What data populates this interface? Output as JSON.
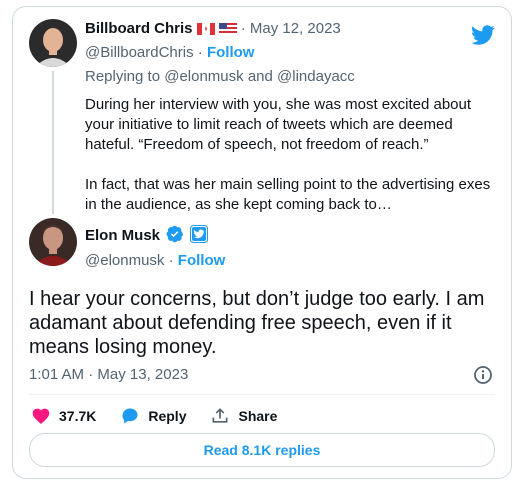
{
  "reply_tweet": {
    "author_name": "Billboard Chris",
    "flags": [
      "canada-flag",
      "usa-flag"
    ],
    "separator": "·",
    "date": "May 12, 2023",
    "handle": "@BillboardChris",
    "follow_label": "Follow",
    "replying_prefix": "Replying to",
    "replying_user1": "@elonmusk",
    "replying_and": "and",
    "replying_user2": "@lindayacc",
    "body": "During her interview with you, she was most excited about your initiative to limit reach of tweets which are deemed hateful. “Freedom of speech, not freedom of reach.”\n\nIn fact, that was her main selling point to the advertising exes in the audience, as she kept coming back to…"
  },
  "main_tweet": {
    "author_name": "Elon Musk",
    "verified_icon": "verified-badge-icon",
    "affiliate_icon": "twitter-affiliate-icon",
    "handle": "@elonmusk",
    "separator": "·",
    "follow_label": "Follow",
    "text": "I hear your concerns, but don’t judge too early. I am adamant about defending free speech, even if it means losing money.",
    "time": "1:01 AM",
    "date_sep": "·",
    "date": "May 13, 2023"
  },
  "actions": {
    "like_count": "37.7K",
    "reply_label": "Reply",
    "share_label": "Share"
  },
  "read_replies_label": "Read 8.1K replies",
  "colors": {
    "accent": "#1d9bf0",
    "like": "#f91880",
    "muted": "#536471",
    "text": "#0f1419",
    "border": "#cfd9de"
  }
}
